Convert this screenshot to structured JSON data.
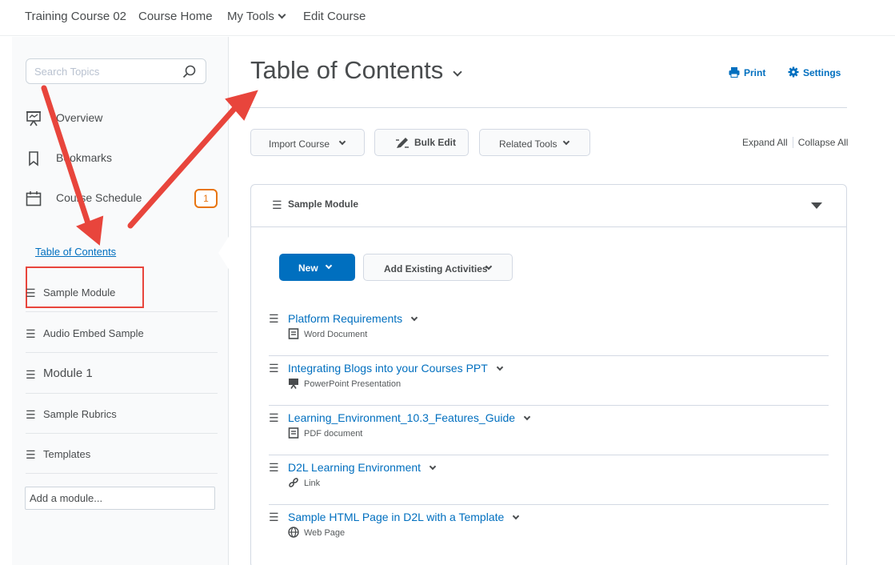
{
  "topnav": {
    "course_name": "Training Course 02",
    "course_home": "Course Home",
    "my_tools": "My Tools",
    "edit_course": "Edit Course"
  },
  "sidebar": {
    "search_placeholder": "Search Topics",
    "overview": "Overview",
    "bookmarks": "Bookmarks",
    "course_schedule": "Course Schedule",
    "schedule_badge": "1",
    "table_of_contents": "Table of Contents",
    "modules": [
      "Sample Module",
      "Audio Embed Sample",
      "Module 1",
      "Sample Rubrics",
      "Templates"
    ],
    "add_module_placeholder": "Add a module..."
  },
  "main": {
    "title": "Table of Contents",
    "print": "Print",
    "settings": "Settings",
    "import_course": "Import Course",
    "bulk_edit": "Bulk Edit",
    "related_tools": "Related Tools",
    "expand_all": "Expand All",
    "collapse_all": "Collapse All",
    "module_name": "Sample Module",
    "new_button": "New",
    "add_existing": "Add Existing Activities",
    "topics": [
      {
        "title": "Platform Requirements",
        "type": "Word Document",
        "icon": "document-icon"
      },
      {
        "title": "Integrating Blogs into your Courses PPT",
        "type": "PowerPoint Presentation",
        "icon": "presentation-icon"
      },
      {
        "title": "Learning_Environment_10.3_Features_Guide",
        "type": "PDF document",
        "icon": "document-icon"
      },
      {
        "title": "D2L Learning Environment",
        "type": "Link",
        "icon": "link-icon"
      },
      {
        "title": "Sample HTML Page in D2L with a Template",
        "type": "Web Page",
        "icon": "globe-icon"
      }
    ]
  },
  "colors": {
    "link": "#006fbf",
    "primary": "#006fbf",
    "badge": "#e87511",
    "annotation_red": "#e8453c",
    "text": "#494c4e"
  }
}
